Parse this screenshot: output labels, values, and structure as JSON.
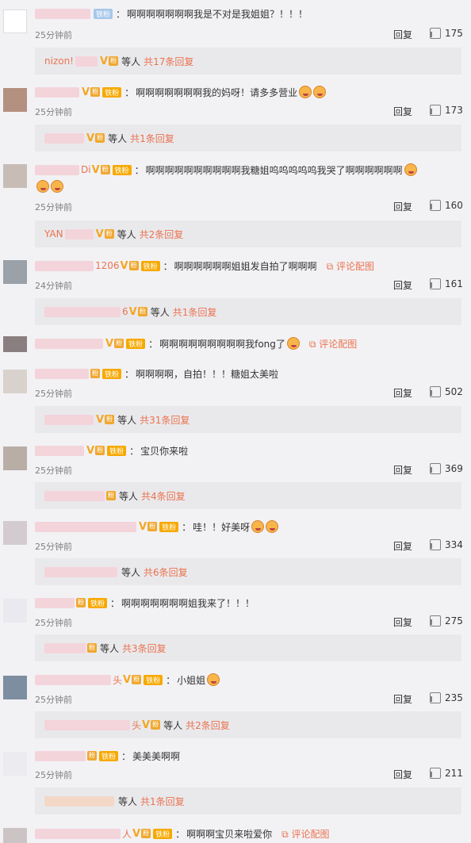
{
  "reply_label": "回复",
  "pic_link_label": "评论配图",
  "deng_ren": "等人",
  "comments": [
    {
      "id": 0,
      "name": "",
      "fan": "铁粉",
      "text": "啊啊啊啊啊啊啊我是不对是我姐姐？！！！",
      "time": "25分钟前",
      "likes": "175",
      "sub_name": "nizon!",
      "sub_total": "共17条回复"
    },
    {
      "id": 1,
      "name": "",
      "fan": "铁粉",
      "text": "啊啊啊啊啊啊啊我的妈呀！请多多营业",
      "time": "25分钟前",
      "likes": "173",
      "sub_name": "",
      "sub_total": "共1条回复"
    },
    {
      "id": 2,
      "name": "Di",
      "fan": "铁粉",
      "text": "啊啊啊啊啊啊啊啊啊啊我糖姐呜呜呜呜呜我哭了啊啊啊啊啊啊",
      "time": "25分钟前",
      "likes": "160",
      "sub_name": "YAN",
      "sub_total": "共2条回复"
    },
    {
      "id": 3,
      "name": "1206",
      "fan": "铁粉",
      "text": "啊啊啊啊啊啊姐姐发自拍了啊啊啊",
      "time": "24分钟前",
      "likes": "161",
      "sub_name": "6",
      "sub_total": "共1条回复",
      "pic": true
    },
    {
      "id": 4,
      "name": "",
      "fan": "铁粉",
      "text": "啊啊啊啊啊啊啊啊啊我fong了",
      "time": "",
      "likes": "",
      "pic": true
    },
    {
      "id": 5,
      "name": "",
      "fan": "铁粉",
      "text": "啊啊啊啊，自拍！！！糖姐太美啦",
      "time": "25分钟前",
      "likes": "502",
      "sub_name": "",
      "sub_total": "共31条回复"
    },
    {
      "id": 6,
      "name": "",
      "fan": "铁粉",
      "text": "宝贝你来啦",
      "time": "25分钟前",
      "likes": "369",
      "sub_name": "",
      "sub_total": "共4条回复"
    },
    {
      "id": 7,
      "name": "",
      "fan": "铁粉",
      "text": "哇！！好美呀",
      "time": "25分钟前",
      "likes": "334",
      "sub_name": "",
      "sub_total": "共6条回复"
    },
    {
      "id": 8,
      "name": "",
      "fan": "铁粉",
      "text": "啊啊啊啊啊啊啊姐我来了！！！",
      "time": "25分钟前",
      "likes": "275",
      "sub_name": "",
      "sub_total": "共3条回复"
    },
    {
      "id": 9,
      "name": "头",
      "fan": "铁粉",
      "text": "小姐姐",
      "time": "25分钟前",
      "likes": "235",
      "sub_name": "头",
      "sub_total": "共2条回复"
    },
    {
      "id": 10,
      "name": "",
      "fan": "铁粉",
      "text": "美美美啊啊",
      "time": "25分钟前",
      "likes": "211",
      "sub_name": "",
      "sub_total": "共1条回复"
    },
    {
      "id": 11,
      "name": "人",
      "fan": "铁粉",
      "text": "啊啊啊宝贝来啦爱你",
      "time": "",
      "likes": "",
      "pic": true
    }
  ]
}
